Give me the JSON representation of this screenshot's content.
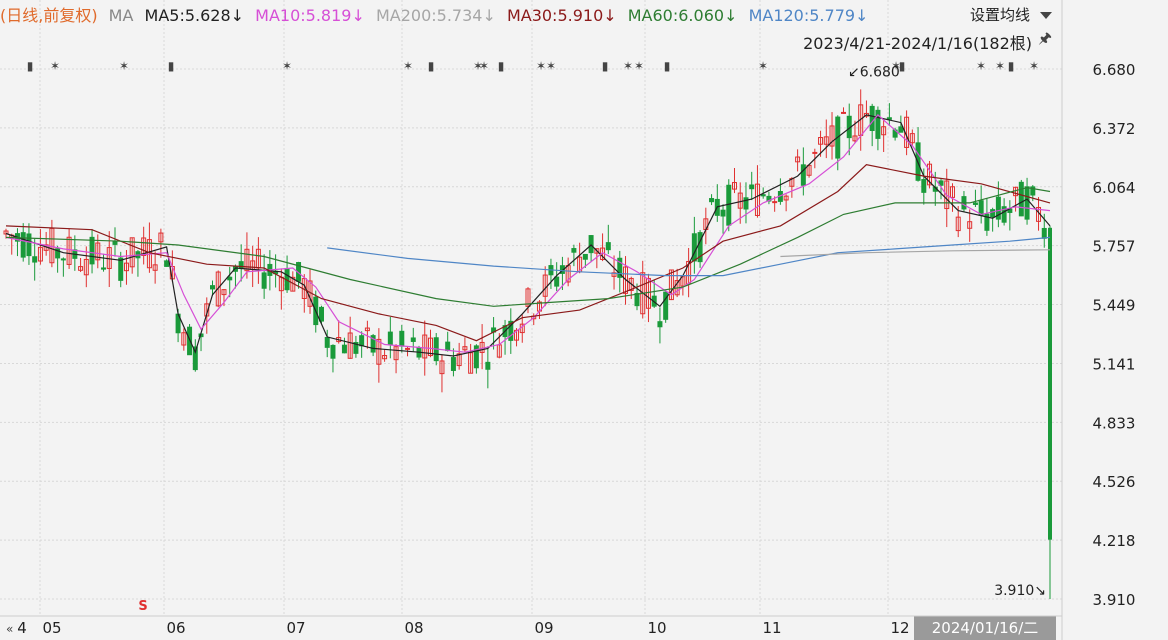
{
  "legend": {
    "prefix": {
      "text": "(日线,前复权)",
      "color": "#e06a2b"
    },
    "ma_label": {
      "text": "MA",
      "color": "#888888"
    },
    "items": [
      {
        "text": "MA5:5.628↓",
        "color": "#222222"
      },
      {
        "text": "MA10:5.819↓",
        "color": "#d64fd6"
      },
      {
        "text": "MA200:5.734↓",
        "color": "#a6a6a6"
      },
      {
        "text": "MA30:5.910↓",
        "color": "#8b1a1a"
      },
      {
        "text": "MA60:6.060↓",
        "color": "#2e7d32"
      },
      {
        "text": "MA120:5.779↓",
        "color": "#4f86c6"
      }
    ]
  },
  "settings_label": "设置均线",
  "range_label": "2023/4/21-2024/1/16(182根)",
  "pin_icon": "pin-icon",
  "colors": {
    "up": "#e03030",
    "down": "#1a9a3a",
    "grid": "#d8d8d8",
    "background": "#f3f3f3"
  },
  "chart_data": {
    "type": "candlestick",
    "y_ticks": [
      "6.680",
      "6.372",
      "6.064",
      "5.757",
      "5.449",
      "5.141",
      "4.833",
      "4.526",
      "4.218",
      "3.910"
    ],
    "ylim": [
      3.91,
      6.68
    ],
    "x_ticks": [
      "4",
      "05",
      "06",
      "07",
      "08",
      "09",
      "10",
      "11",
      "12",
      "2024/01/16/二"
    ],
    "high_annotation": "6.680",
    "low_annotation": "3.910",
    "last_candle": {
      "open": 5.85,
      "high": 5.86,
      "low": 3.91,
      "close": 4.22
    },
    "series": [
      {
        "name": "MA5",
        "color": "#222222",
        "points": [
          [
            0,
            5.82
          ],
          [
            10,
            5.72
          ],
          [
            20,
            5.68
          ],
          [
            28,
            5.75
          ],
          [
            30,
            5.4
          ],
          [
            33,
            5.2
          ],
          [
            36,
            5.5
          ],
          [
            40,
            5.64
          ],
          [
            48,
            5.62
          ],
          [
            52,
            5.55
          ],
          [
            56,
            5.28
          ],
          [
            64,
            5.22
          ],
          [
            72,
            5.2
          ],
          [
            78,
            5.18
          ],
          [
            84,
            5.22
          ],
          [
            90,
            5.4
          ],
          [
            96,
            5.6
          ],
          [
            102,
            5.76
          ],
          [
            108,
            5.58
          ],
          [
            114,
            5.44
          ],
          [
            118,
            5.6
          ],
          [
            124,
            5.96
          ],
          [
            130,
            6.0
          ],
          [
            138,
            6.12
          ],
          [
            144,
            6.3
          ],
          [
            150,
            6.44
          ],
          [
            156,
            6.4
          ],
          [
            160,
            6.12
          ],
          [
            166,
            5.94
          ],
          [
            172,
            5.9
          ],
          [
            178,
            6.0
          ],
          [
            182,
            5.86
          ]
        ]
      },
      {
        "name": "MA10",
        "color": "#d64fd6",
        "points": [
          [
            0,
            5.8
          ],
          [
            10,
            5.74
          ],
          [
            20,
            5.7
          ],
          [
            28,
            5.72
          ],
          [
            31,
            5.5
          ],
          [
            34,
            5.32
          ],
          [
            38,
            5.46
          ],
          [
            42,
            5.62
          ],
          [
            50,
            5.64
          ],
          [
            54,
            5.54
          ],
          [
            58,
            5.36
          ],
          [
            66,
            5.24
          ],
          [
            74,
            5.22
          ],
          [
            80,
            5.2
          ],
          [
            86,
            5.24
          ],
          [
            92,
            5.38
          ],
          [
            98,
            5.58
          ],
          [
            104,
            5.72
          ],
          [
            110,
            5.62
          ],
          [
            116,
            5.5
          ],
          [
            120,
            5.58
          ],
          [
            126,
            5.86
          ],
          [
            132,
            5.98
          ],
          [
            140,
            6.08
          ],
          [
            146,
            6.22
          ],
          [
            152,
            6.44
          ],
          [
            158,
            6.28
          ],
          [
            164,
            6.02
          ],
          [
            170,
            5.92
          ],
          [
            176,
            5.96
          ],
          [
            182,
            5.94
          ]
        ]
      },
      {
        "name": "MA30",
        "color": "#8b1a1a",
        "points": [
          [
            0,
            5.86
          ],
          [
            15,
            5.84
          ],
          [
            25,
            5.72
          ],
          [
            35,
            5.66
          ],
          [
            45,
            5.64
          ],
          [
            55,
            5.48
          ],
          [
            65,
            5.4
          ],
          [
            75,
            5.34
          ],
          [
            82,
            5.26
          ],
          [
            90,
            5.38
          ],
          [
            100,
            5.42
          ],
          [
            110,
            5.54
          ],
          [
            118,
            5.64
          ],
          [
            125,
            5.78
          ],
          [
            135,
            5.86
          ],
          [
            145,
            6.04
          ],
          [
            150,
            6.18
          ],
          [
            160,
            6.12
          ],
          [
            170,
            6.08
          ],
          [
            182,
            5.98
          ]
        ]
      },
      {
        "name": "MA60",
        "color": "#2e7d32",
        "points": [
          [
            0,
            5.8
          ],
          [
            20,
            5.78
          ],
          [
            30,
            5.76
          ],
          [
            45,
            5.7
          ],
          [
            60,
            5.58
          ],
          [
            75,
            5.48
          ],
          [
            85,
            5.44
          ],
          [
            95,
            5.46
          ],
          [
            105,
            5.48
          ],
          [
            118,
            5.54
          ],
          [
            128,
            5.66
          ],
          [
            138,
            5.8
          ],
          [
            146,
            5.92
          ],
          [
            155,
            5.98
          ],
          [
            168,
            5.98
          ],
          [
            178,
            6.06
          ],
          [
            182,
            6.04
          ]
        ]
      },
      {
        "name": "MA120",
        "color": "#4f86c6",
        "points": [
          [
            56,
            5.745
          ],
          [
            70,
            5.69
          ],
          [
            85,
            5.65
          ],
          [
            100,
            5.62
          ],
          [
            115,
            5.6
          ],
          [
            125,
            5.6
          ],
          [
            135,
            5.66
          ],
          [
            145,
            5.72
          ],
          [
            155,
            5.74
          ],
          [
            165,
            5.76
          ],
          [
            175,
            5.78
          ],
          [
            182,
            5.8
          ]
        ]
      },
      {
        "name": "MA200",
        "color": "#a6a6a6",
        "points": [
          [
            135,
            5.7
          ],
          [
            150,
            5.72
          ],
          [
            165,
            5.73
          ],
          [
            182,
            5.735
          ]
        ]
      }
    ]
  }
}
